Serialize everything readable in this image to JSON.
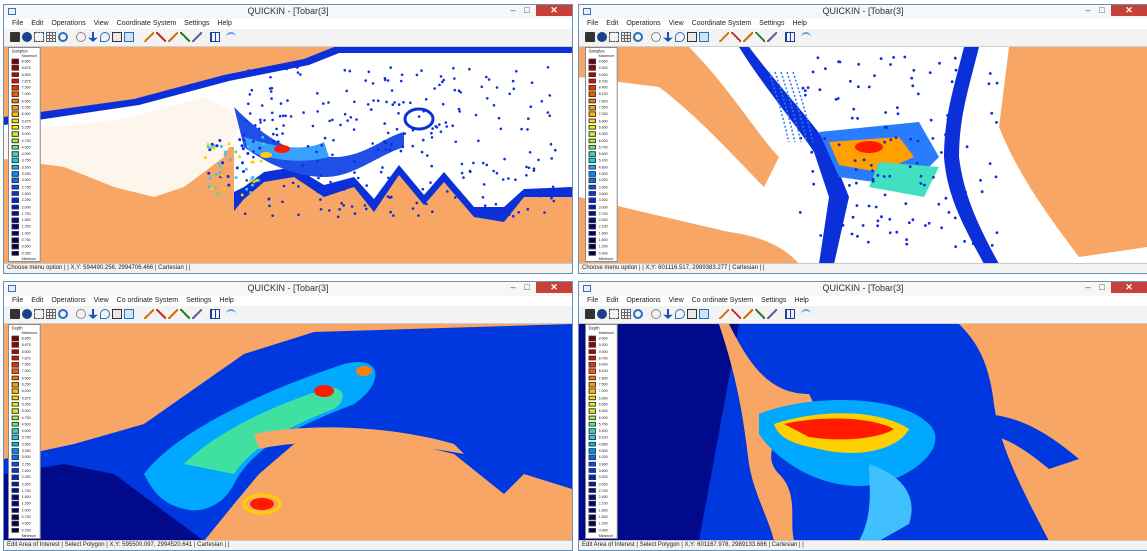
{
  "windows": [
    {
      "title": "QUICKIN - [Tobar(3]",
      "menu": [
        "File",
        "Edit",
        "Operations",
        "View",
        "Coordinate System",
        "Settings",
        "Help"
      ],
      "status": "Choose menu option | | X,Y:   594490.258,   2994706.466 |  Cartesian | |",
      "mode": "samples",
      "legend": {
        "title": "Samples",
        "top": "Maximum",
        "bottom": "Minimum",
        "values": [
          "8.850",
          "8.675",
          "8.500",
          "7.875",
          "7.500",
          "7.000",
          "6.500",
          "6.250",
          "6.000",
          "5.875",
          "5.250",
          "5.000",
          "4.750",
          "4.500",
          "4.000",
          "3.750",
          "3.500",
          "3.250",
          "3.000",
          "2.750",
          "2.500",
          "2.250",
          "2.000",
          "1.750",
          "1.500",
          "1.250",
          "1.000",
          "0.750",
          "0.500",
          "0.250"
        ]
      }
    },
    {
      "title": "QUICKIN - [Tobar(3]",
      "menu": [
        "File",
        "Edit",
        "Operations",
        "View",
        "Coordinate System",
        "Settings",
        "Help"
      ],
      "status": "Choose menu option | | X,Y:   601116.517,   2989383.277 |  Cartesian | |",
      "mode": "samples",
      "legend": {
        "title": "Samples",
        "top": "Maximum",
        "bottom": "Minimum",
        "values": [
          "9.600",
          "9.300",
          "9.000",
          "8.700",
          "8.400",
          "8.100",
          "7.800",
          "7.500",
          "7.200",
          "6.900",
          "6.600",
          "6.300",
          "6.000",
          "5.700",
          "5.400",
          "5.100",
          "4.800",
          "4.500",
          "4.200",
          "3.900",
          "3.600",
          "3.300",
          "3.000",
          "2.700",
          "2.400",
          "2.100",
          "1.800",
          "1.500",
          "1.200",
          "0.900"
        ]
      }
    },
    {
      "title": "QUICKIN - [Tobar(3]",
      "menu": [
        "File",
        "Edit",
        "Operations",
        "View",
        "Co ordinate System",
        "Settings",
        "Help"
      ],
      "status": "Edit Area of Interest | Select Polygon |  X,Y:   595500.097,   2994520.641 |  Cartesian | |",
      "mode": "depth",
      "legend": {
        "title": "Depth",
        "top": "Maximum",
        "bottom": "Minimum",
        "values": [
          "8.850",
          "8.675",
          "8.500",
          "7.875",
          "7.500",
          "7.000",
          "6.500",
          "6.250",
          "6.000",
          "5.875",
          "5.250",
          "5.000",
          "4.750",
          "4.500",
          "4.000",
          "3.750",
          "3.500",
          "3.250",
          "3.000",
          "2.750",
          "2.500",
          "2.250",
          "2.000",
          "1.750",
          "1.500",
          "1.250",
          "1.000",
          "0.750",
          "0.500",
          "0.250"
        ]
      }
    },
    {
      "title": "QUICKIN - [Tobar(3]",
      "menu": [
        "File",
        "Edit",
        "Operations",
        "View",
        "Co ordinate System",
        "Settings",
        "Help"
      ],
      "status": "Edit Area of Interest | Select Polygon |  X,Y:   601167.978,   2989133.686 |  Cartesian | |",
      "mode": "depth",
      "legend": {
        "title": "Depth",
        "top": "Maximum",
        "bottom": "Minimum",
        "values": [
          "9.600",
          "9.300",
          "9.000",
          "8.700",
          "8.400",
          "8.100",
          "7.800",
          "7.500",
          "7.200",
          "6.900",
          "6.600",
          "6.300",
          "6.000",
          "5.700",
          "5.400",
          "5.100",
          "4.800",
          "4.500",
          "4.200",
          "3.900",
          "3.600",
          "3.300",
          "3.000",
          "2.700",
          "2.400",
          "2.100",
          "1.800",
          "1.500",
          "1.200",
          "0.900"
        ]
      }
    }
  ],
  "window_controls": {
    "minimize": "–",
    "maximize": "□",
    "close": "✕"
  },
  "toolbar_icons": [
    "print-icon",
    "dot-icon",
    "zoom-extent-icon",
    "grid-icon",
    "zoom-icon",
    "target-icon",
    "anchor-icon",
    "rotate-icon",
    "select-box-icon",
    "polygon-icon",
    "line-tool-icon",
    "edit-line-icon",
    "line-tool-2-icon",
    "zoom-line-icon",
    "path-icon",
    "table-icon",
    "wave-icon"
  ],
  "colors": {
    "land": "#f7a665",
    "water": "#ffffff",
    "deep": "#000a8a",
    "mid": "#0038e0",
    "light": "#00a8ff",
    "hot": "#ff1a00",
    "title_accent": "#c7413a",
    "legend_ramp": [
      "#7a0000",
      "#9b0000",
      "#c00000",
      "#de1000",
      "#f03000",
      "#ff5a00",
      "#ff7a00",
      "#ff9a00",
      "#ffba00",
      "#ffd800",
      "#f0f000",
      "#c8f020",
      "#98f050",
      "#68e880",
      "#40d8b0",
      "#20c8e0",
      "#10b0f8",
      "#0090ff",
      "#0070ff",
      "#0050f8",
      "#0038e8",
      "#0028d0",
      "#0018b8",
      "#0010a0",
      "#000890",
      "#000080",
      "#000070",
      "#000060",
      "#000050",
      "#000040"
    ]
  }
}
